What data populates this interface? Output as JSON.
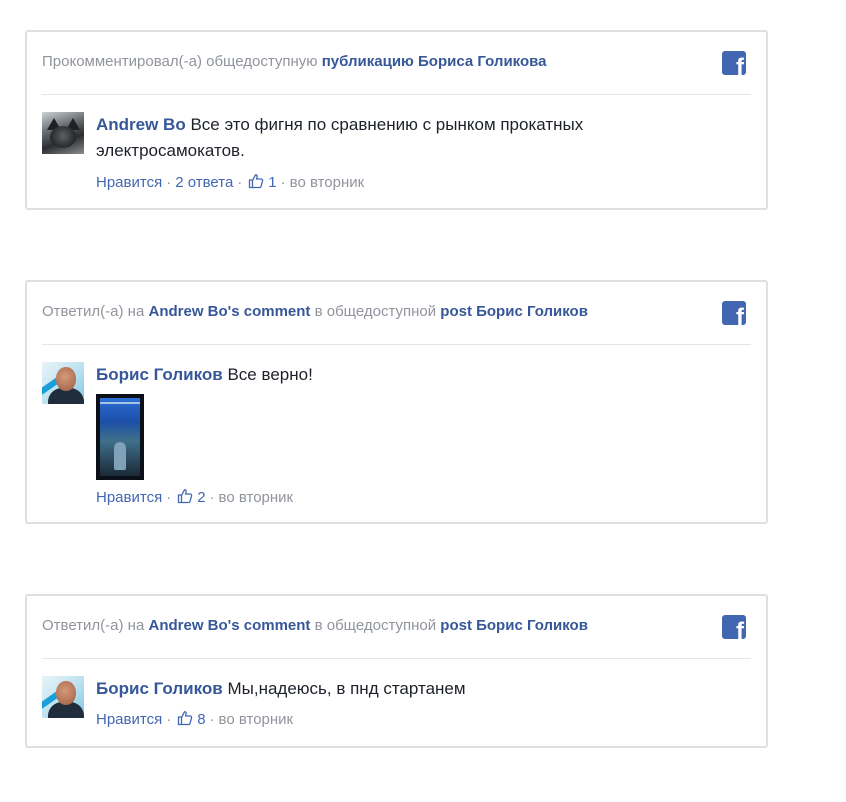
{
  "cards": [
    {
      "header": {
        "prefix": "Прокомментировал(-а) общедоступную ",
        "link": "публикацию Бориса Голикова"
      },
      "comment": {
        "author": "Andrew Bo",
        "text_line1": " Все это фигня по сравнению с рынком прокатных",
        "text_line2": "электросамокатов."
      },
      "meta": {
        "like_label": "Нравится",
        "replies_label": "2 ответа",
        "likes_count": "1",
        "time": "во вторник"
      }
    },
    {
      "header": {
        "prefix": "Ответил(-а) на ",
        "link1": "Andrew Bo's comment",
        "middle": " в общедоступной ",
        "link2": "post Борис Голиков"
      },
      "comment": {
        "author": "Борис Голиков",
        "text": " Все верно!"
      },
      "meta": {
        "like_label": "Нравится",
        "likes_count": "2",
        "time": "во вторник"
      }
    },
    {
      "header": {
        "prefix": "Ответил(-а) на ",
        "link1": "Andrew Bo's comment",
        "middle": " в общедоступной ",
        "link2": "post Борис Голиков"
      },
      "comment": {
        "author": "Борис Голиков",
        "text": " Мы,надеюсь, в пнд стартанем"
      },
      "meta": {
        "like_label": "Нравится",
        "likes_count": "8",
        "time": "во вторник"
      }
    }
  ],
  "icons": {
    "facebook": "facebook-icon",
    "like": "thumbs-up-icon"
  },
  "colors": {
    "link": "#365899",
    "muted": "#90949c",
    "facebook_blue": "#4267b2",
    "border": "#dddfe2"
  }
}
